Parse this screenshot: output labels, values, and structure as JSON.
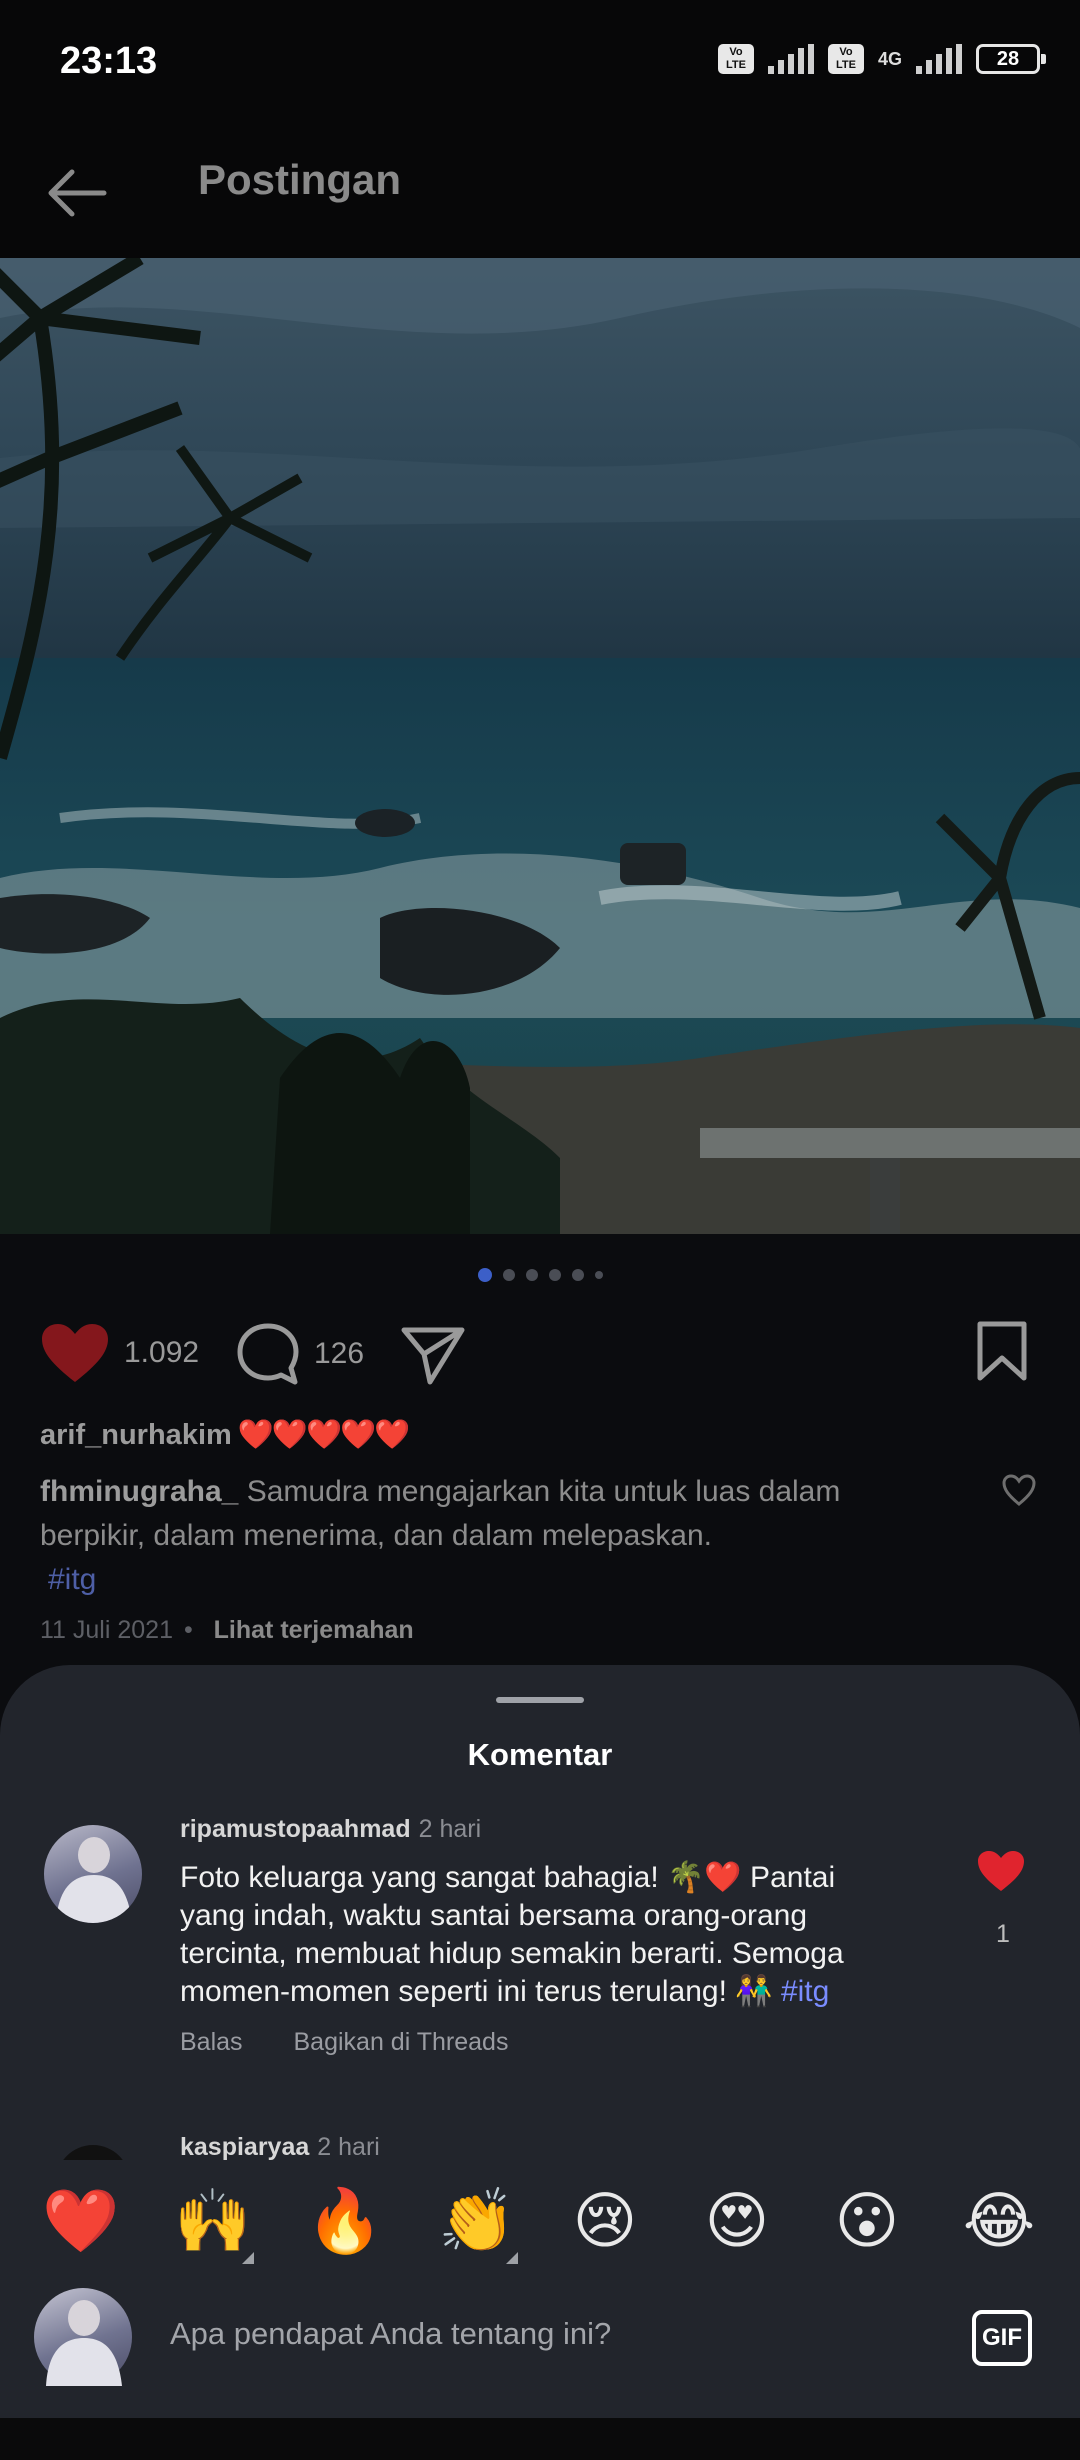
{
  "status_bar": {
    "time": "23:13",
    "volte_label": "Vo LTE",
    "network": "4G",
    "battery": "28"
  },
  "header": {
    "title": "Postingan"
  },
  "post": {
    "carousel_count": 6,
    "carousel_active": 0,
    "likes": "1.092",
    "comments": "126",
    "liked_by": {
      "user": "arif_nurhakim",
      "hearts": "❤️❤️❤️❤️❤️"
    },
    "caption": {
      "user": "fhminugraha_",
      "text": "Samudra mengajarkan kita untuk luas dalam berpikir, dalam menerima, dan dalam melepaskan.",
      "hashtag": "#itg"
    },
    "date": "11 Juli 2021",
    "separator": "•",
    "translate": "Lihat terjemahan"
  },
  "comments_sheet": {
    "title": "Komentar",
    "comments": [
      {
        "user": "ripamustopaahmad",
        "time": "2 hari",
        "text": "Foto keluarga yang sangat bahagia! 🌴❤️ Pantai yang indah, waktu santai bersama orang-orang tercinta, membuat hidup semakin berarti. Semoga momen-momen seperti ini terus terulang! 👫",
        "hashtag": "#itg",
        "reply": "Balas",
        "share": "Bagikan di Threads",
        "like_count": "1"
      },
      {
        "user": "kaspiaryaa",
        "time": "2 hari"
      }
    ]
  },
  "composer": {
    "emojis": [
      "❤️",
      "🙌",
      "🔥",
      "👏",
      "😢",
      "😍",
      "😮",
      "😂"
    ],
    "placeholder": "Apa pendapat Anda tentang ini?",
    "gif_label": "GIF"
  },
  "colors": {
    "like_red": "#e0242e",
    "hashtag_blue": "#7a8cff",
    "sheet_bg": "#22252c"
  }
}
